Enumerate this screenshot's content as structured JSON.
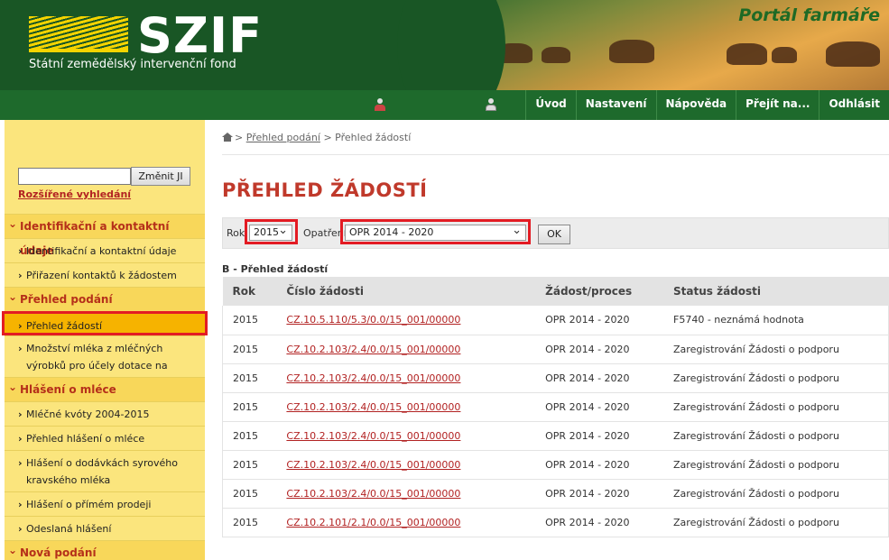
{
  "header": {
    "logo_text": "SZIF",
    "logo_subtitle": "Státní zemědělský intervenční fond",
    "portal_title": "Portál farmáře"
  },
  "nav": {
    "links": [
      "Úvod",
      "Nastavení",
      "Nápověda",
      "Přejít na...",
      "Odhlásit"
    ]
  },
  "sidebar": {
    "search_button": "Změnit JI",
    "advanced_search": "Rozšířené vyhledání",
    "menu": [
      {
        "type": "cat",
        "label": "Identifikační a kontaktní údaje"
      },
      {
        "type": "item",
        "label": "Identifikační a kontaktní údaje"
      },
      {
        "type": "item",
        "label": "Přiřazení kontaktů k žádostem"
      },
      {
        "type": "cat",
        "label": "Přehled podání"
      },
      {
        "type": "item",
        "label": "Přehled žádostí",
        "active": true
      },
      {
        "type": "item",
        "label": "Množství mléka z mléčných výrobků pro účely dotace na dojnice",
        "double": true
      },
      {
        "type": "cat",
        "label": "Hlášení o mléce"
      },
      {
        "type": "item",
        "label": "Mléčné kvóty 2004-2015"
      },
      {
        "type": "item",
        "label": "Přehled hlášení o mléce"
      },
      {
        "type": "item",
        "label": "Hlášení o dodávkách syrového kravského mléka",
        "double": true
      },
      {
        "type": "item",
        "label": "Hlášení o přímém prodeji"
      },
      {
        "type": "item",
        "label": "Odeslaná hlášení"
      },
      {
        "type": "cat",
        "label": "Nová podání"
      }
    ]
  },
  "breadcrumb": {
    "link": "Přehled podání",
    "separator": ">",
    "current": "Přehled žádostí"
  },
  "page_title": "PŘEHLED ŽÁDOSTÍ",
  "filter": {
    "year_label": "Rok",
    "year_value": "2015",
    "measure_label": "Opatření",
    "measure_value": "OPR 2014 - 2020",
    "ok_label": "OK"
  },
  "section_title": "B - Přehled žádostí",
  "table": {
    "headers": [
      "Rok",
      "Číslo žádosti",
      "Žádost/proces",
      "Status žádosti"
    ],
    "rows": [
      [
        "2015",
        "CZ.10.5.110/5.3/0.0/15_001/00000",
        "OPR 2014 - 2020",
        "F5740 - neznámá hodnota"
      ],
      [
        "2015",
        "CZ.10.2.103/2.4/0.0/15_001/00000",
        "OPR 2014 - 2020",
        "Zaregistrování Žádosti o podporu"
      ],
      [
        "2015",
        "CZ.10.2.103/2.4/0.0/15_001/00000",
        "OPR 2014 - 2020",
        "Zaregistrování Žádosti o podporu"
      ],
      [
        "2015",
        "CZ.10.2.103/2.4/0.0/15_001/00000",
        "OPR 2014 - 2020",
        "Zaregistrování Žádosti o podporu"
      ],
      [
        "2015",
        "CZ.10.2.103/2.4/0.0/15_001/00000",
        "OPR 2014 - 2020",
        "Zaregistrování Žádosti o podporu"
      ],
      [
        "2015",
        "CZ.10.2.103/2.4/0.0/15_001/00000",
        "OPR 2014 - 2020",
        "Zaregistrování Žádosti o podporu"
      ],
      [
        "2015",
        "CZ.10.2.103/2.4/0.0/15_001/00000",
        "OPR 2014 - 2020",
        "Zaregistrování Žádosti o podporu"
      ],
      [
        "2015",
        "CZ.10.2.101/2.1/0.0/15_001/00000",
        "OPR 2014 - 2020",
        "Zaregistrování Žádosti o podporu"
      ]
    ]
  },
  "colors": {
    "header_green": "#195625",
    "nav_green": "#1e6a2c",
    "sidebar_yellow": "#fbe57d",
    "accent_red": "#c0392b",
    "highlight_red": "#e31b23"
  }
}
